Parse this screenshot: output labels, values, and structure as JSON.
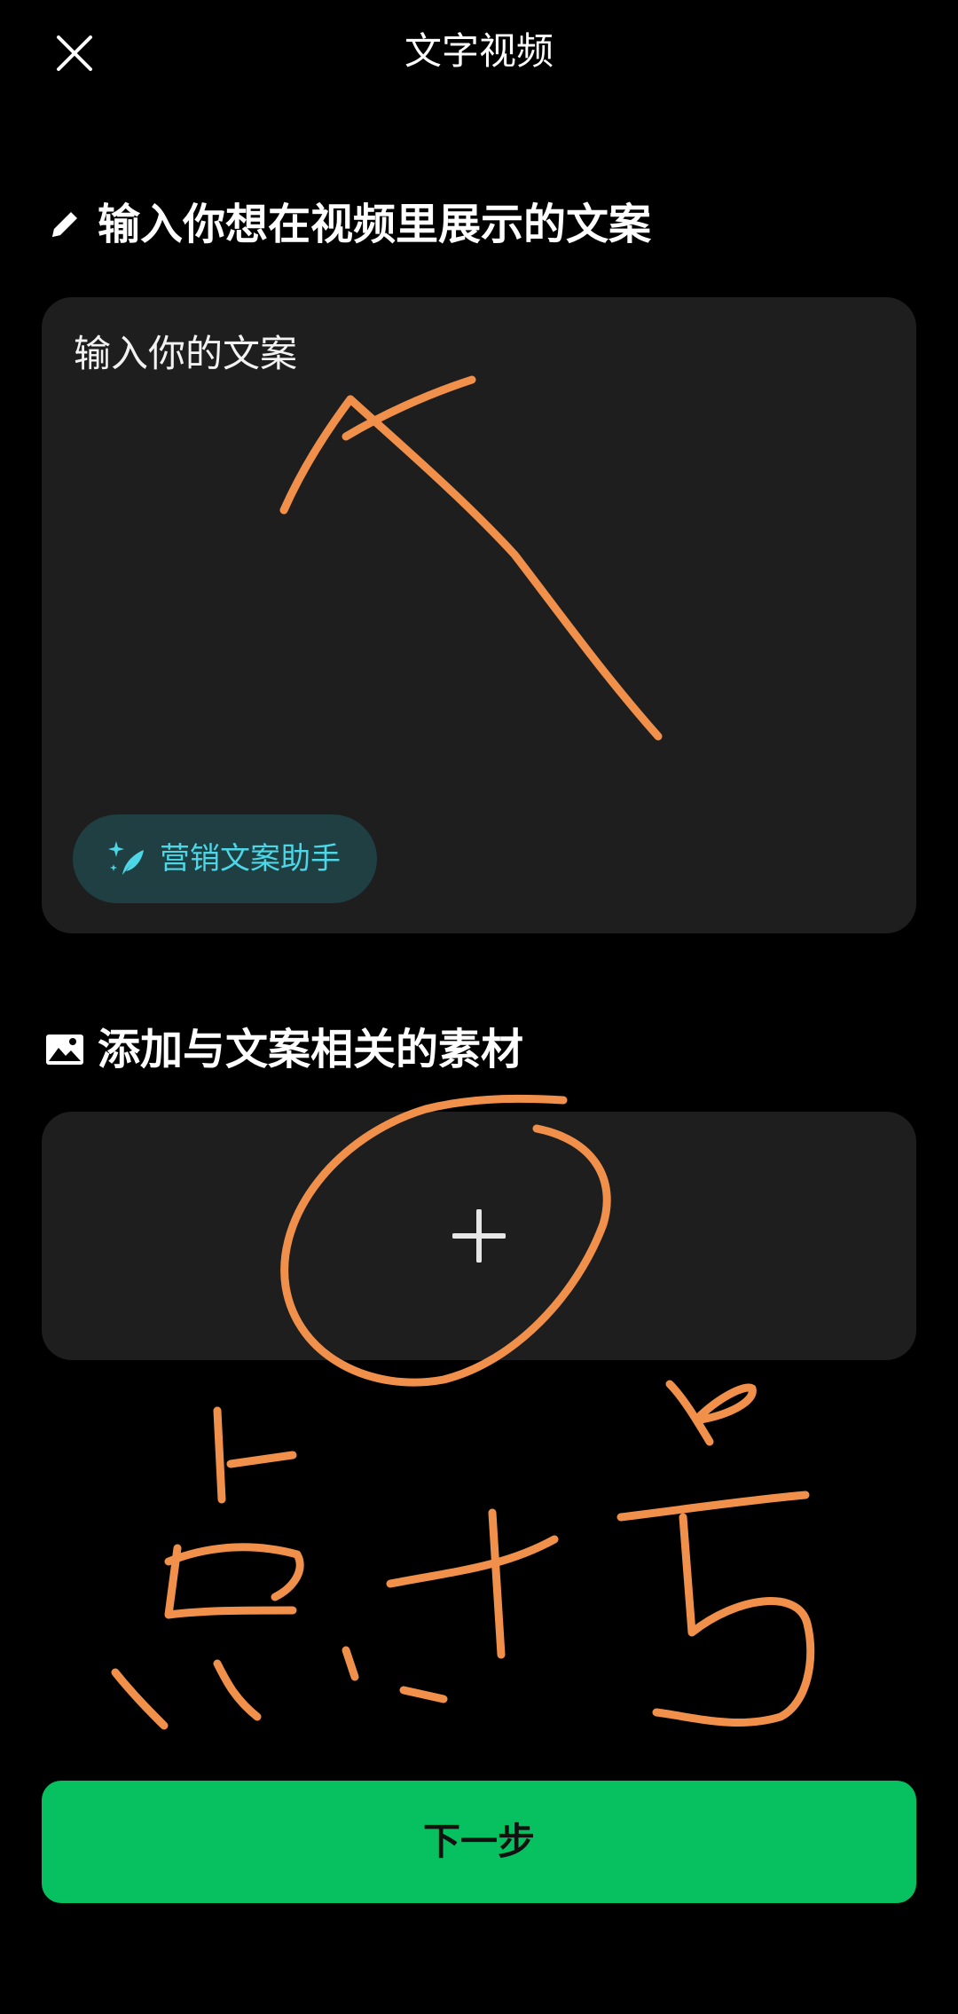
{
  "header": {
    "title": "文字视频",
    "close_icon": "close-icon"
  },
  "copy_section": {
    "heading": "输入你想在视频里展示的文案",
    "heading_icon": "pencil-icon",
    "input_placeholder": "输入你的文案",
    "input_value": "",
    "assistant_label": "营销文案助手",
    "assistant_icon": "sparkle-quill-icon"
  },
  "media_section": {
    "heading": "添加与文案相关的素材",
    "heading_icon": "image-icon",
    "add_icon": "plus-icon"
  },
  "footer": {
    "next_label": "下一步"
  },
  "colors": {
    "background": "#000000",
    "card": "#1e1e1e",
    "accent_green": "#07c160",
    "assistant_chip_bg": "#1f3f43",
    "assistant_chip_text": "#4dd6e6",
    "annotation_orange": "#f0904a"
  },
  "annotations": {
    "handwriting_icon": "handwritten-annotation-icon"
  }
}
